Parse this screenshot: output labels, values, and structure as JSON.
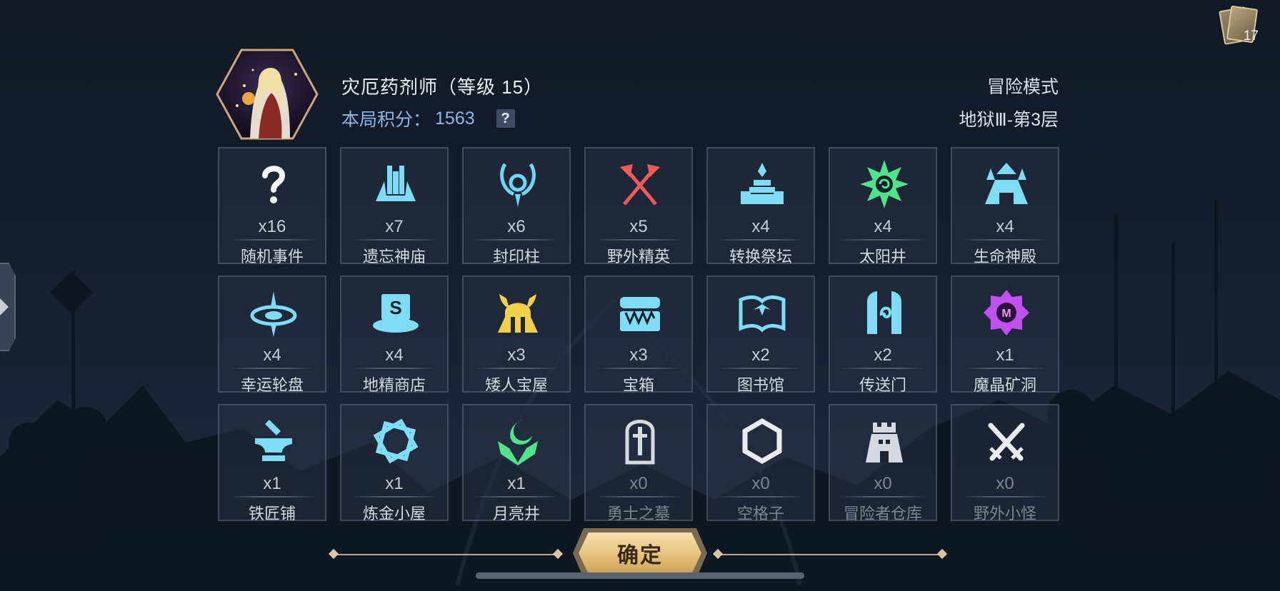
{
  "hero": {
    "name": "灾厄药剂师（等级 15）",
    "score_label": "本局积分：",
    "score_value": "1563",
    "help": "?"
  },
  "mode": {
    "title": "冒险模式",
    "floor": "地狱Ⅲ-第3层"
  },
  "deck": {
    "count": "17"
  },
  "tiles": [
    {
      "count": "x16",
      "label": "随机事件",
      "icon": "question-icon",
      "color": "#f4f6fa"
    },
    {
      "count": "x7",
      "label": "遗忘神庙",
      "icon": "temple-icon",
      "color": "#7fdcf5"
    },
    {
      "count": "x6",
      "label": "封印柱",
      "icon": "seal-pillar-icon",
      "color": "#6fd6f2"
    },
    {
      "count": "x5",
      "label": "野外精英",
      "icon": "crossed-axes-icon",
      "color": "#f25a5a"
    },
    {
      "count": "x4",
      "label": "转换祭坛",
      "icon": "altar-icon",
      "color": "#7fdcf5"
    },
    {
      "count": "x4",
      "label": "太阳井",
      "icon": "sun-well-icon",
      "color": "#4fe38a"
    },
    {
      "count": "x4",
      "label": "生命神殿",
      "icon": "life-temple-icon",
      "color": "#7fdcf5"
    },
    {
      "count": "x4",
      "label": "幸运轮盘",
      "icon": "wheel-icon",
      "color": "#7fdcf5"
    },
    {
      "count": "x4",
      "label": "地精商店",
      "icon": "goblin-shop-icon",
      "color": "#7fdcf5"
    },
    {
      "count": "x3",
      "label": "矮人宝屋",
      "icon": "dwarf-helmet-icon",
      "color": "#f2d04a"
    },
    {
      "count": "x3",
      "label": "宝箱",
      "icon": "treasure-chest-icon",
      "color": "#7fdcf5"
    },
    {
      "count": "x2",
      "label": "图书馆",
      "icon": "book-icon",
      "color": "#7fdcf5"
    },
    {
      "count": "x2",
      "label": "传送门",
      "icon": "portal-icon",
      "color": "#7fdcf5"
    },
    {
      "count": "x1",
      "label": "魔晶矿洞",
      "icon": "crystal-mine-icon",
      "color": "#c050f0"
    },
    {
      "count": "x1",
      "label": "铁匠铺",
      "icon": "anvil-icon",
      "color": "#7fdcf5"
    },
    {
      "count": "x1",
      "label": "炼金小屋",
      "icon": "alchemy-icon",
      "color": "#7fdcf5"
    },
    {
      "count": "x1",
      "label": "月亮井",
      "icon": "moon-well-icon",
      "color": "#4fe38a"
    },
    {
      "count": "x0",
      "label": "勇士之墓",
      "icon": "tomb-icon",
      "color": "#d6d9df"
    },
    {
      "count": "x0",
      "label": "空格子",
      "icon": "hexagon-icon",
      "color": "#e9ebef"
    },
    {
      "count": "x0",
      "label": "冒险者仓库",
      "icon": "warehouse-icon",
      "color": "#d6d9df"
    },
    {
      "count": "x0",
      "label": "野外小怪",
      "icon": "crossed-swords-icon",
      "color": "#e9ebef"
    }
  ],
  "confirm": {
    "label": "确定"
  }
}
